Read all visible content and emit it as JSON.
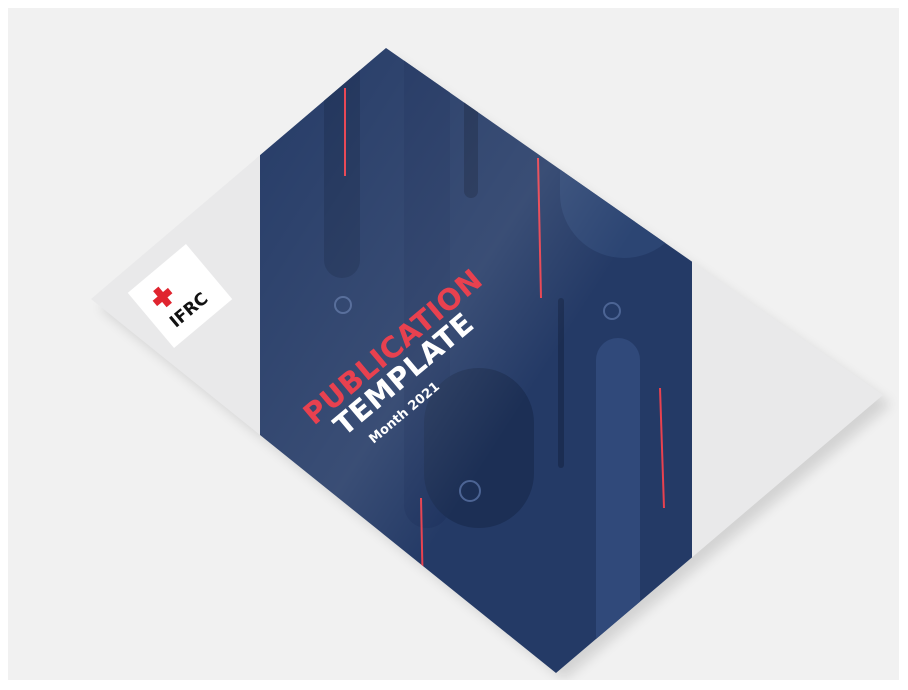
{
  "cover": {
    "title_line1": "PUBLICATION",
    "title_line2": "TEMPLATE",
    "subtitle": "Month 2021"
  },
  "logo": {
    "text": "IFRC",
    "icon": "red-cross-red-crescent-emblem"
  },
  "colors": {
    "background": "#f1f1f1",
    "cover_navy": "#243a66",
    "cover_navy_dark": "#1c2f55",
    "accent_red": "#e8414f",
    "logo_red": "#e0242f",
    "paper": "#e9e9ea"
  }
}
